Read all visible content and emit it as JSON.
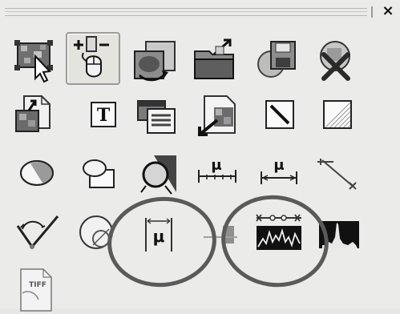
{
  "toolbar": {
    "close_label": "×"
  },
  "tools": [
    {
      "name": "select-region-tool",
      "icon": "select-region-icon"
    },
    {
      "name": "add-remove-selection-tool",
      "icon": "add-remove-mouse-icon",
      "selected": true
    },
    {
      "name": "rotate-image-tool",
      "icon": "rotate-image-icon"
    },
    {
      "name": "open-folder-tool",
      "icon": "open-folder-icon"
    },
    {
      "name": "save-copy-tool",
      "icon": "save-copy-icon"
    },
    {
      "name": "delete-selection-tool",
      "icon": "delete-selection-icon"
    },
    {
      "name": "export-document-tool",
      "icon": "export-document-icon"
    },
    {
      "name": "text-tool",
      "icon": "text-icon",
      "label": "T"
    },
    {
      "name": "image-info-tool",
      "icon": "image-info-icon"
    },
    {
      "name": "import-image-tool",
      "icon": "import-image-icon"
    },
    {
      "name": "line-tool",
      "icon": "line-icon"
    },
    {
      "name": "rectangle-tool",
      "icon": "rectangle-icon"
    },
    {
      "name": "ellipse-tool",
      "icon": "ellipse-icon"
    },
    {
      "name": "overlap-shapes-tool",
      "icon": "overlap-shapes-icon"
    },
    {
      "name": "circle-fill-tool",
      "icon": "circle-fill-icon"
    },
    {
      "name": "measure-length-tool",
      "icon": "measure-length-icon",
      "label": "μ"
    },
    {
      "name": "measure-distance-tool",
      "icon": "measure-distance-icon",
      "label": "μ"
    },
    {
      "name": "angle-line-tool",
      "icon": "angle-line-icon"
    },
    {
      "name": "angle-tool",
      "icon": "angle-icon"
    },
    {
      "name": "circle-measure-tool",
      "icon": "circle-measure-icon"
    },
    {
      "name": "vertical-measure-tool",
      "icon": "vertical-measure-icon",
      "label": "μ"
    },
    {
      "name": "partial-measure-tool",
      "icon": "partial-measure-icon"
    },
    {
      "name": "line-profile-tool",
      "icon": "line-profile-icon"
    },
    {
      "name": "histogram-tool",
      "icon": "histogram-icon"
    },
    {
      "name": "tiff-export-tool",
      "icon": "tiff-file-icon",
      "label": "TIFF"
    }
  ]
}
